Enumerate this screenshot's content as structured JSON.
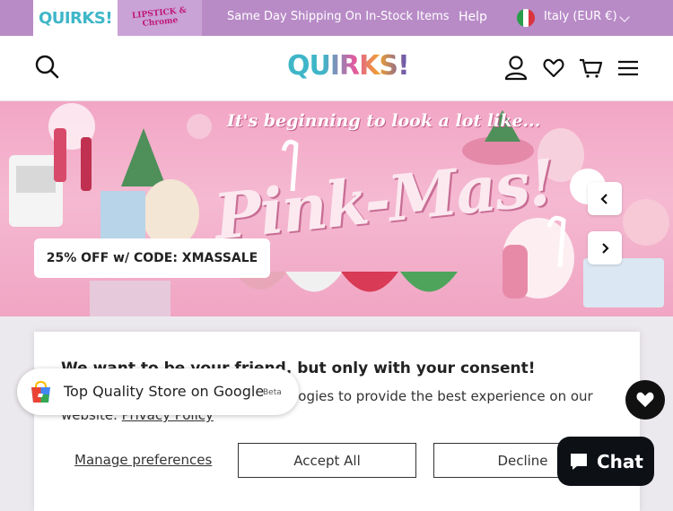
{
  "topbar": {
    "brand_quirks": "QUIRKS!",
    "brand_lipstick": "LIPSTICK & Chrome",
    "shipping_text": "Same Day Shipping On In-Stock Items",
    "help_label": "Help",
    "currency_label": "Italy (EUR €)"
  },
  "header": {
    "logo_text": "QUIRKS!"
  },
  "banner": {
    "heading": "It's beginning to look a lot like...",
    "script_text": "Pink-Mas!",
    "promo_text": "25% OFF w/ CODE: XMASSALE"
  },
  "consent": {
    "title": "We want to be your friend, but only with your consent!",
    "text_start": "We use cookies and similar technologies to provide the best experience on our website.",
    "privacy_link": "Privacy Policy",
    "manage_label": "Manage preferences",
    "accept_label": "Accept All",
    "decline_label": "Decline"
  },
  "google_badge": {
    "text": "Top Quality Store on Google",
    "beta": "Beta"
  },
  "chat": {
    "label": "Chat"
  },
  "colors": {
    "topbar": "#b88bc7",
    "accent_pink": "#e05aa0",
    "accent_teal": "#3fb6c8"
  }
}
